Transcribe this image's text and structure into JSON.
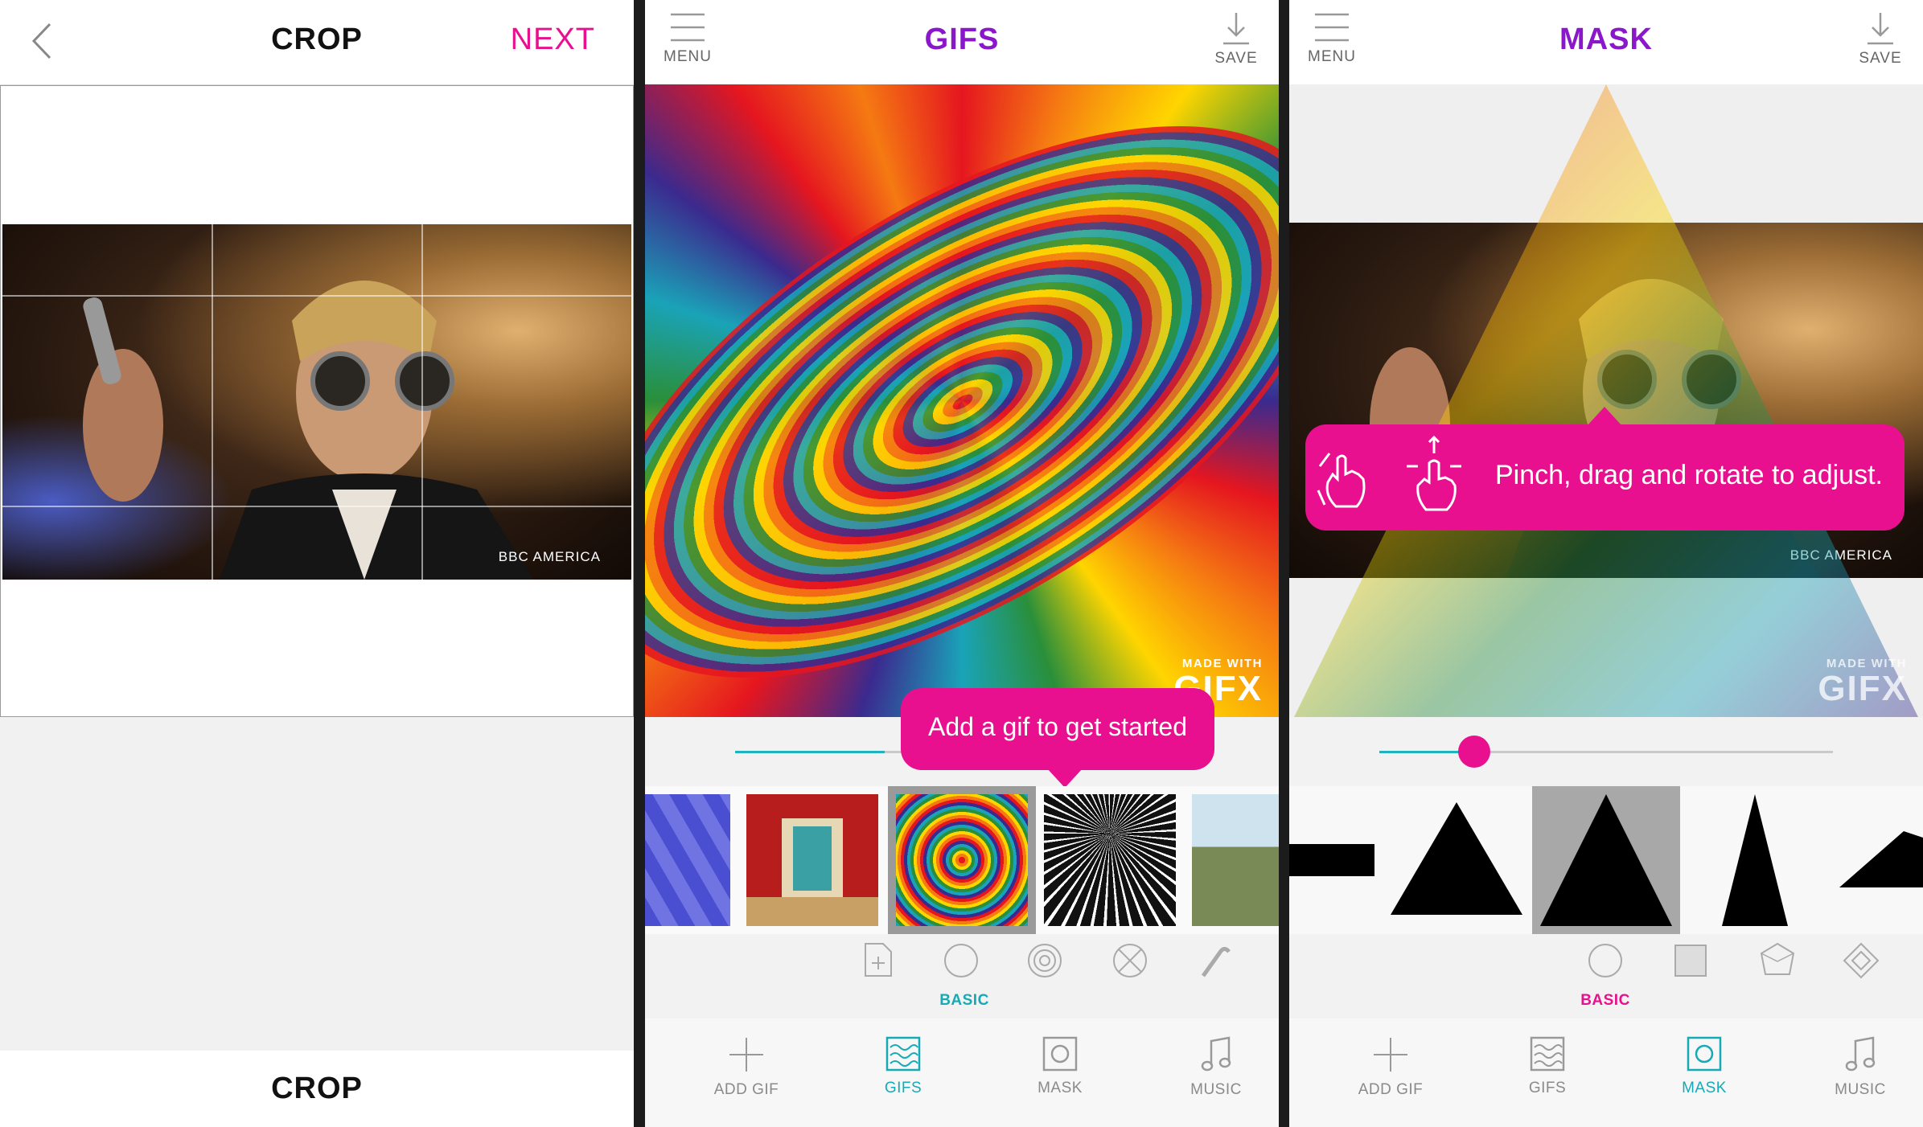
{
  "crop": {
    "title": "CROP",
    "next_label": "NEXT",
    "bottom_title": "CROP",
    "watermark": "BBC AMERICA"
  },
  "gifs": {
    "menu_label": "MENU",
    "title": "GIFS",
    "save_label": "SAVE",
    "made_with": "MADE WITH",
    "gifx": "GIFX",
    "tooltip": "Add a gif to get started",
    "slider_value": 0.33,
    "category_label": "BASIC",
    "nav": [
      "ADD GIF",
      "GIFS",
      "MASK",
      "MUSIC"
    ],
    "active_nav": "GIFS"
  },
  "mask": {
    "menu_label": "MENU",
    "title": "MASK",
    "save_label": "SAVE",
    "made_with": "MADE WITH",
    "gifx": "GIFX",
    "watermark": "BBC AMERICA",
    "tooltip": "Pinch, drag and rotate to adjust.",
    "slider_value": 0.21,
    "category_label": "BASIC",
    "nav": [
      "ADD GIF",
      "GIFS",
      "MASK",
      "MUSIC"
    ],
    "active_nav": "MASK"
  },
  "colors": {
    "pink": "#e8108e",
    "purple": "#8a17c9",
    "teal": "#16aab6"
  }
}
